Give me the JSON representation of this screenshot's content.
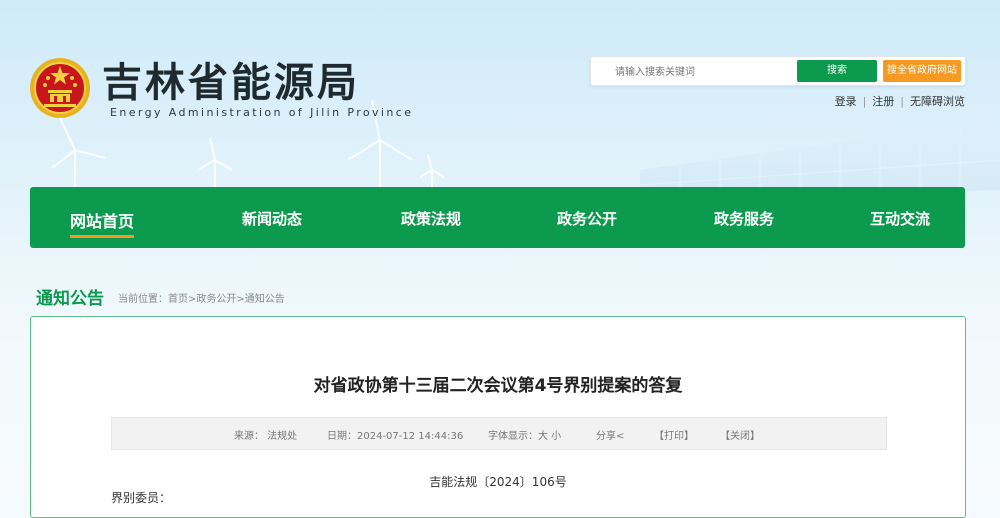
{
  "header": {
    "title": "吉林省能源局",
    "subtitle": "Energy Administration of Jilin Province"
  },
  "search": {
    "placeholder": "请输入搜索关键词",
    "button_label": "搜索",
    "province_button_label": "搜全省政府网站"
  },
  "top_links": {
    "login": "登录",
    "register": "注册",
    "accessibility": "无障碍浏览"
  },
  "nav": {
    "items": [
      {
        "label": "网站首页"
      },
      {
        "label": "新闻动态"
      },
      {
        "label": "政策法规"
      },
      {
        "label": "政务公开"
      },
      {
        "label": "政务服务"
      },
      {
        "label": "互动交流"
      }
    ]
  },
  "section": {
    "title": "通知公告",
    "breadcrumb": "当前位置：首页>政务公开>通知公告"
  },
  "article": {
    "title": "对省政协第十三届二次会议第4号界别提案的答复",
    "source": "来源：  法规处",
    "date": "日期：2024-07-12 14:44:36",
    "font_size_label": "字体显示：大  小",
    "share": "分享",
    "print": "【打印】",
    "close": "【关闭】",
    "doc_number": "吉能法规〔2024〕106号",
    "salutation": "界别委员："
  },
  "colors": {
    "primary_green": "#0c9a4f",
    "accent_orange": "#f59a23"
  }
}
